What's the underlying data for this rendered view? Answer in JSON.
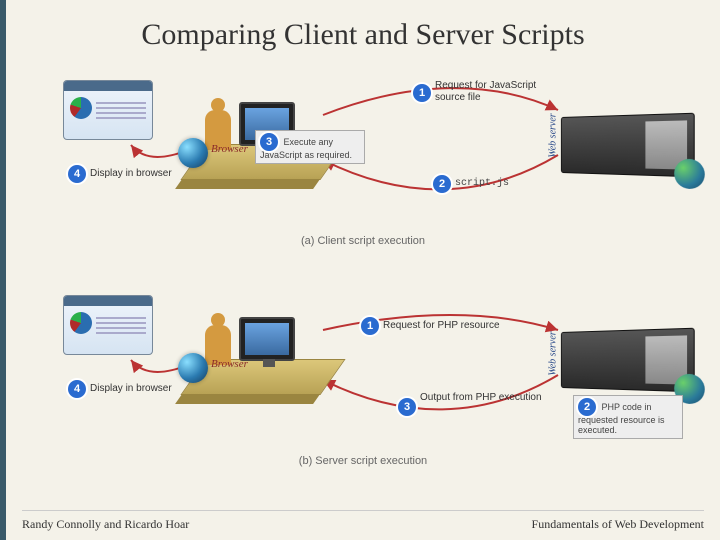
{
  "title": "Comparing Client and Server Scripts",
  "footer": {
    "left": "Randy Connolly and Ricardo Hoar",
    "right": "Fundamentals of Web Development"
  },
  "labels": {
    "browser": "Browser",
    "web_server": "Web server"
  },
  "panel_a": {
    "caption": "(a) Client script execution",
    "steps": {
      "s1": {
        "num": "1",
        "text": "Request for JavaScript source file"
      },
      "s2": {
        "num": "2",
        "text": "script.js"
      },
      "s3": {
        "num": "3",
        "text": "Execute any JavaScript as required."
      },
      "s4": {
        "num": "4",
        "text": "Display in browser"
      }
    }
  },
  "panel_b": {
    "caption": "(b) Server script execution",
    "steps": {
      "s1": {
        "num": "1",
        "text": "Request for PHP resource"
      },
      "s2": {
        "num": "2",
        "text": "PHP code in requested resource is executed."
      },
      "s3": {
        "num": "3",
        "text": "Output from PHP execution"
      },
      "s4": {
        "num": "4",
        "text": "Display in browser"
      }
    }
  }
}
